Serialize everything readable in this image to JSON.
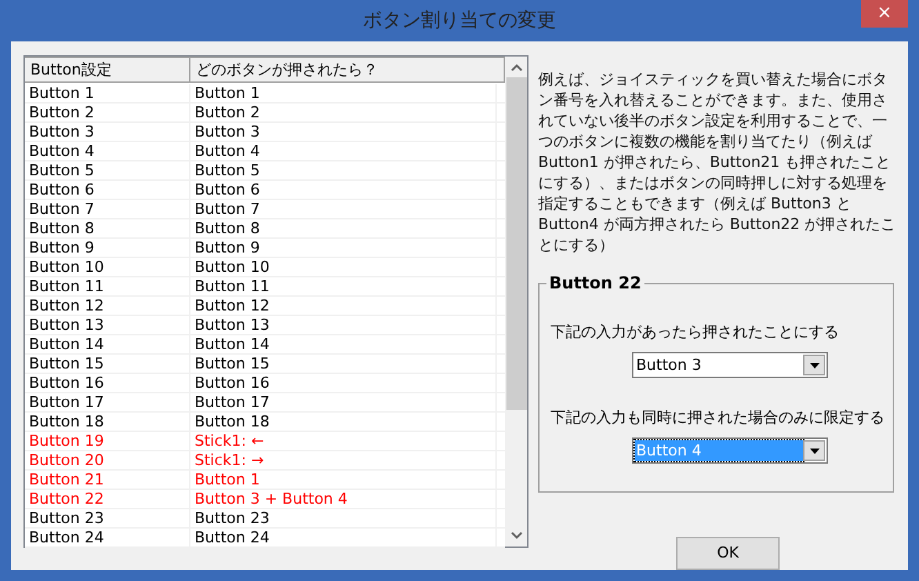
{
  "window": {
    "title": "ボタン割り当ての変更",
    "close_label": "×"
  },
  "table": {
    "columns": [
      "Button設定",
      "どのボタンが押されたら？"
    ],
    "rows": [
      {
        "cells": [
          "Button 1",
          "Button 1"
        ],
        "modified": false
      },
      {
        "cells": [
          "Button 2",
          "Button 2"
        ],
        "modified": false
      },
      {
        "cells": [
          "Button 3",
          "Button 3"
        ],
        "modified": false
      },
      {
        "cells": [
          "Button 4",
          "Button 4"
        ],
        "modified": false
      },
      {
        "cells": [
          "Button 5",
          "Button 5"
        ],
        "modified": false
      },
      {
        "cells": [
          "Button 6",
          "Button 6"
        ],
        "modified": false
      },
      {
        "cells": [
          "Button 7",
          "Button 7"
        ],
        "modified": false
      },
      {
        "cells": [
          "Button 8",
          "Button 8"
        ],
        "modified": false
      },
      {
        "cells": [
          "Button 9",
          "Button 9"
        ],
        "modified": false
      },
      {
        "cells": [
          "Button 10",
          "Button 10"
        ],
        "modified": false
      },
      {
        "cells": [
          "Button 11",
          "Button 11"
        ],
        "modified": false
      },
      {
        "cells": [
          "Button 12",
          "Button 12"
        ],
        "modified": false
      },
      {
        "cells": [
          "Button 13",
          "Button 13"
        ],
        "modified": false
      },
      {
        "cells": [
          "Button 14",
          "Button 14"
        ],
        "modified": false
      },
      {
        "cells": [
          "Button 15",
          "Button 15"
        ],
        "modified": false
      },
      {
        "cells": [
          "Button 16",
          "Button 16"
        ],
        "modified": false
      },
      {
        "cells": [
          "Button 17",
          "Button 17"
        ],
        "modified": false
      },
      {
        "cells": [
          "Button 18",
          "Button 18"
        ],
        "modified": false
      },
      {
        "cells": [
          "Button 19",
          "Stick1: ←"
        ],
        "modified": true
      },
      {
        "cells": [
          "Button 20",
          "Stick1: →"
        ],
        "modified": true
      },
      {
        "cells": [
          "Button 21",
          "Button 1"
        ],
        "modified": true
      },
      {
        "cells": [
          "Button 22",
          "Button 3 + Button 4"
        ],
        "modified": true
      },
      {
        "cells": [
          "Button 23",
          "Button 23"
        ],
        "modified": false
      },
      {
        "cells": [
          "Button 24",
          "Button 24"
        ],
        "modified": false
      }
    ]
  },
  "description": "例えば、ジョイスティックを買い替えた場合にボタン番号を入れ替えることができます。また、使用されていない後半のボタン設定を利用することで、一つのボタンに複数の機能を割り当てたり（例えば Button1 が押されたら、Button21 も押されたことにする）、またはボタンの同時押しに対する処理を指定することもできます（例えば Button3 と Button4 が両方押されたら Button22 が押されたことにする）",
  "group": {
    "title": "Button 22",
    "fields": [
      {
        "label": "下記の入力があったら押されたことにする",
        "value": "Button 3",
        "focused": false
      },
      {
        "label": "下記の入力も同時に押された場合のみに限定する",
        "value": "Button 4",
        "focused": true
      }
    ]
  },
  "buttons": [
    "OK"
  ]
}
